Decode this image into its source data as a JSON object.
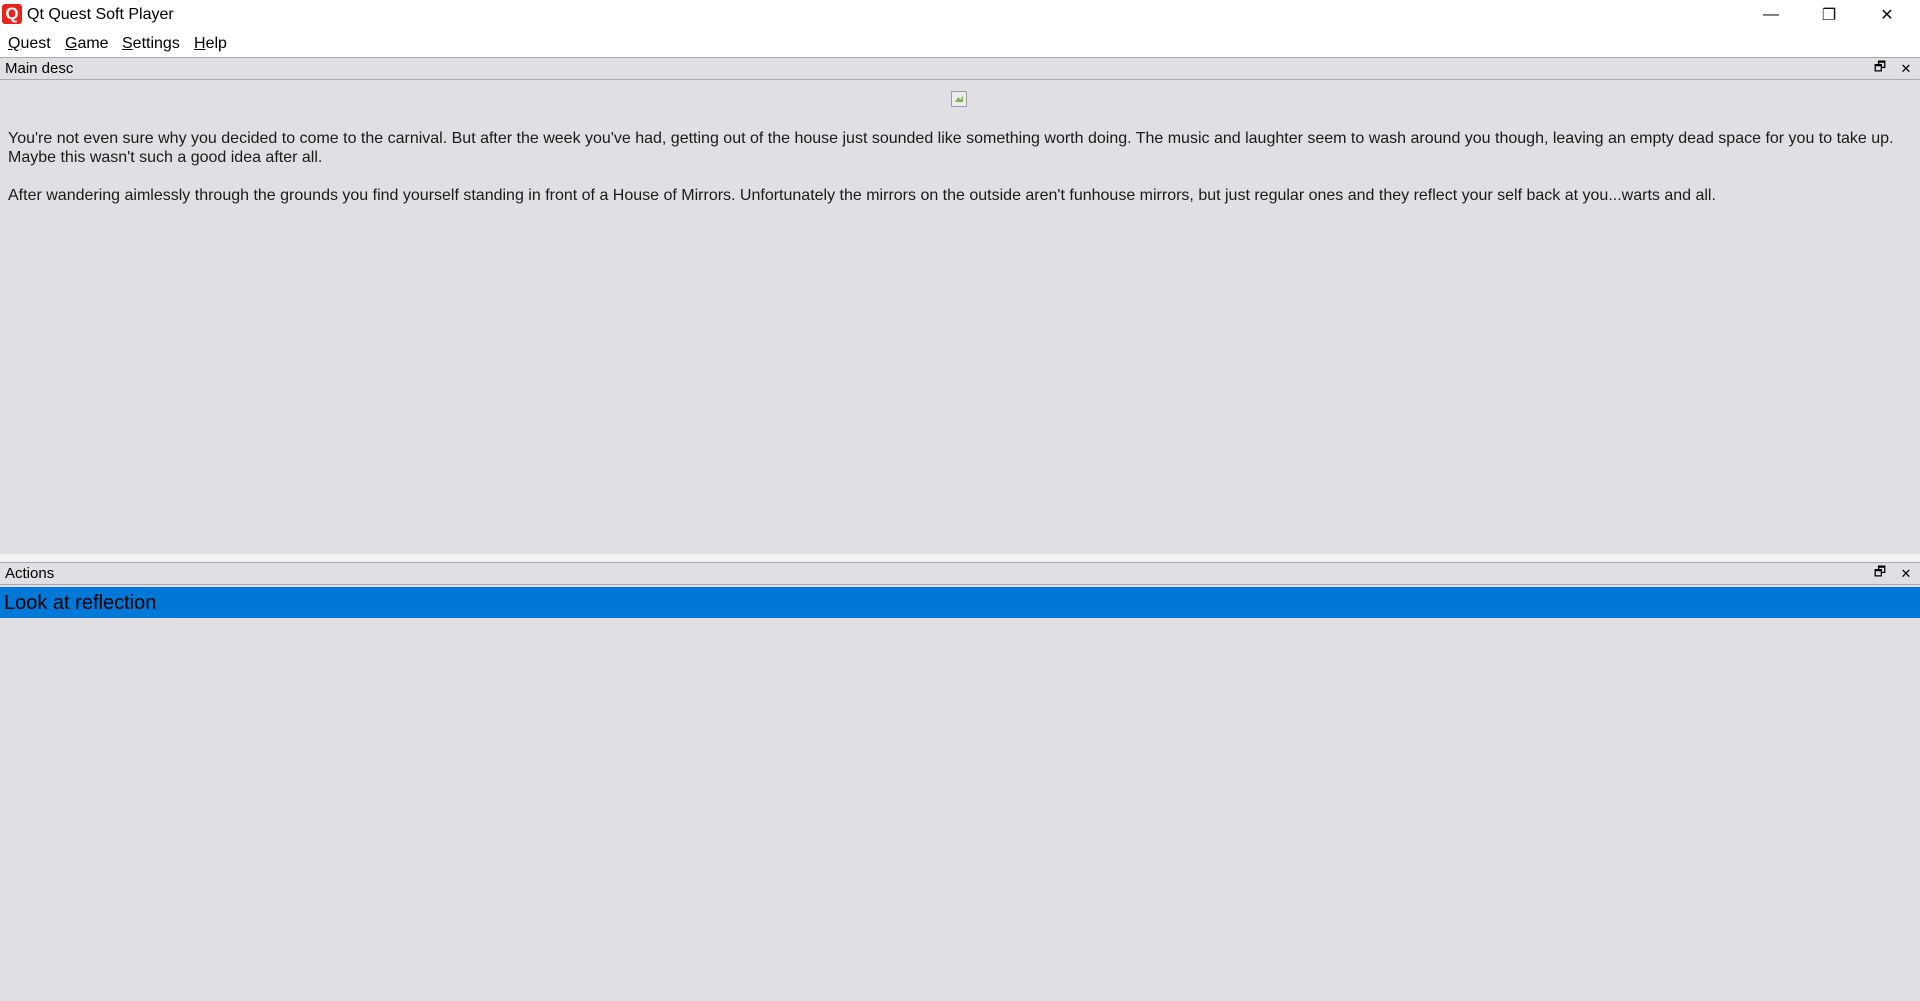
{
  "window": {
    "title": "Qt Quest Soft Player",
    "app_icon_glyph": "Q",
    "controls": {
      "minimize_glyph": "—",
      "maximize_glyph": "❐",
      "close_glyph": "✕"
    }
  },
  "menubar": {
    "items": [
      {
        "accel": "Q",
        "rest": "uest"
      },
      {
        "accel": "G",
        "rest": "ame"
      },
      {
        "accel": "S",
        "rest": "ettings"
      },
      {
        "accel": "H",
        "rest": "elp"
      }
    ]
  },
  "main_desc": {
    "title": "Main desc",
    "float_glyph": "🗗",
    "close_glyph": "✕",
    "paragraphs": [
      "You're not even sure why you decided to come to the carnival. But after the week you've had, getting out of the house just sounded like something worth doing. The music and laughter seem to wash around you though, leaving an empty dead space for you to take up. Maybe this wasn't such a good idea after all.",
      "After wandering aimlessly through the grounds you find yourself standing in front of a House of Mirrors. Unfortunately the mirrors on the outside aren't funhouse mirrors, but just regular ones and they reflect your self back at you...warts and all."
    ]
  },
  "actions": {
    "title": "Actions",
    "float_glyph": "🗗",
    "close_glyph": "✕",
    "items": [
      {
        "label": "Look at reflection",
        "selected": true
      }
    ]
  },
  "colors": {
    "background": "#e0dfe3",
    "selection": "#0078d7",
    "icon_red": "#e8231b"
  }
}
